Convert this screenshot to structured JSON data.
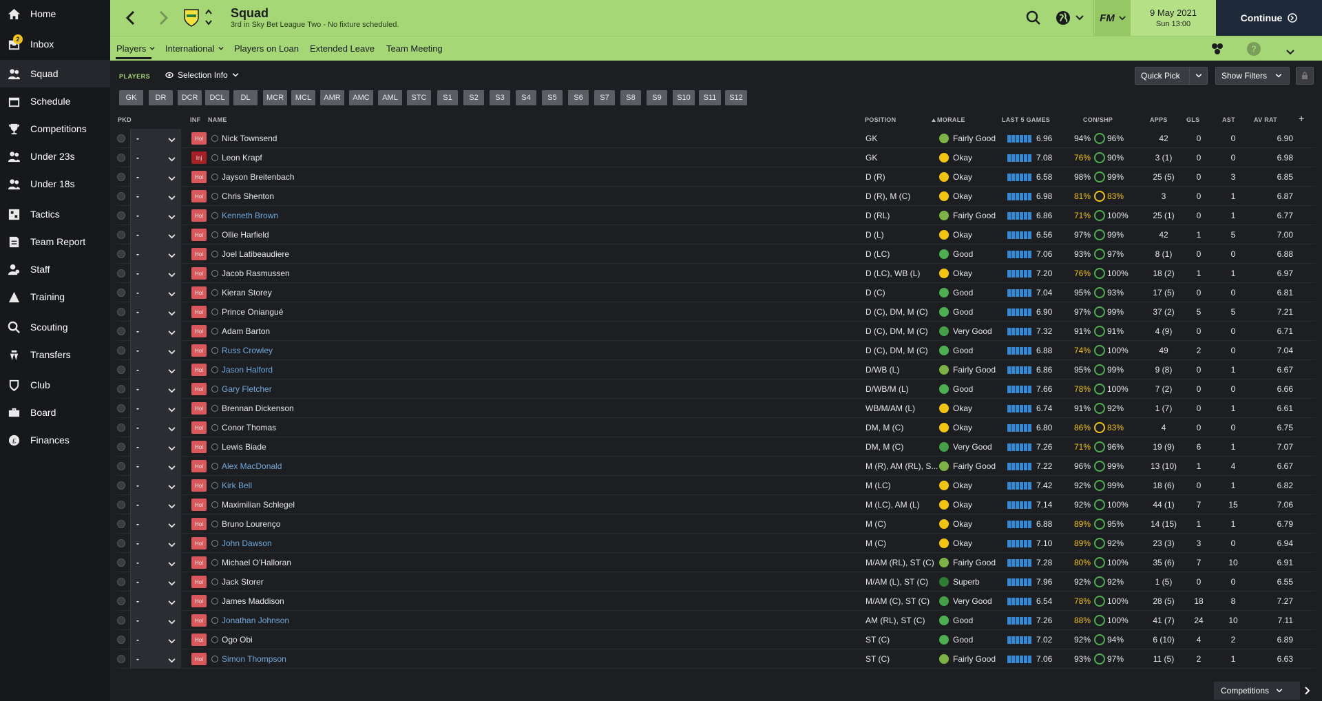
{
  "sidebar": {
    "items": [
      {
        "label": "Home",
        "icon": "home-icon"
      },
      {
        "label": "Inbox",
        "icon": "inbox-icon",
        "badge": "2"
      },
      {
        "label": "Squad",
        "icon": "squad-icon",
        "active": true
      },
      {
        "label": "Schedule",
        "icon": "calendar-icon"
      },
      {
        "label": "Competitions",
        "icon": "trophy-icon"
      },
      {
        "label": "Under 23s",
        "icon": "u23-icon"
      },
      {
        "label": "Under 18s",
        "icon": "u18-icon"
      },
      {
        "label": "Tactics",
        "icon": "tactics-icon"
      },
      {
        "label": "Team Report",
        "icon": "report-icon"
      },
      {
        "label": "Staff",
        "icon": "staff-icon"
      },
      {
        "label": "Training",
        "icon": "training-icon"
      },
      {
        "label": "Scouting",
        "icon": "scouting-icon"
      },
      {
        "label": "Transfers",
        "icon": "transfers-icon"
      },
      {
        "label": "Club",
        "icon": "club-icon"
      },
      {
        "label": "Board",
        "icon": "board-icon"
      },
      {
        "label": "Finances",
        "icon": "finances-icon"
      }
    ]
  },
  "header": {
    "title": "Squad",
    "subtitle": "3rd in Sky Bet League Two - No fixture scheduled.",
    "date": "9 May 2021",
    "time": "Sun 13:00",
    "continue_label": "Continue",
    "fm_label": "FM"
  },
  "subnav": {
    "items": [
      "Players",
      "International",
      "Players on Loan",
      "Extended Leave",
      "Team Meeting"
    ]
  },
  "toolbar": {
    "players_label": "PLAYERS",
    "selection_info": "Selection Info",
    "quick_pick": "Quick Pick",
    "show_filters": "Show Filters"
  },
  "positions": [
    "GK",
    "DR",
    "DCR",
    "DCL",
    "DL",
    "MCR",
    "MCL",
    "AMR",
    "AMC",
    "AML",
    "STC",
    "S1",
    "S2",
    "S3",
    "S4",
    "S5",
    "S6",
    "S7",
    "S8",
    "S9",
    "S10",
    "S11",
    "S12"
  ],
  "columns": {
    "pkd": "PKD",
    "inf": "INF",
    "name": "NAME",
    "position": "POSITION",
    "morale": "MORALE",
    "last5": "LAST 5 GAMES",
    "conshp": "CON/SHP",
    "apps": "APPS",
    "gls": "GLS",
    "ast": "AST",
    "avrat": "AV RAT"
  },
  "players": [
    {
      "pkd": "-",
      "inf": "Hol",
      "name": "Nick Townsend",
      "link": false,
      "position": "GK",
      "morale": "Fairly Good",
      "morale_color": "#7cb342",
      "last5": "6.96",
      "con": "94%",
      "shp": "96%",
      "apps": "42",
      "gls": "0",
      "ast": "0",
      "avrat": "6.90"
    },
    {
      "pkd": "-",
      "inf": "Inj",
      "name": "Leon Krapf",
      "link": false,
      "position": "GK",
      "morale": "Okay",
      "morale_color": "#f1c40f",
      "last5": "7.08",
      "con": "76%",
      "shp": "90%",
      "apps": "3 (1)",
      "gls": "0",
      "ast": "0",
      "avrat": "6.98"
    },
    {
      "pkd": "-",
      "inf": "Hol",
      "name": "Jayson Breitenbach",
      "link": false,
      "position": "D (R)",
      "morale": "Okay",
      "morale_color": "#f1c40f",
      "last5": "6.58",
      "con": "98%",
      "shp": "99%",
      "apps": "25 (5)",
      "gls": "0",
      "ast": "3",
      "avrat": "6.85"
    },
    {
      "pkd": "-",
      "inf": "Hol",
      "name": "Chris Shenton",
      "link": false,
      "position": "D (R), M (C)",
      "morale": "Okay",
      "morale_color": "#f1c40f",
      "last5": "6.98",
      "con": "81%",
      "shp": "83%",
      "apps": "3",
      "gls": "0",
      "ast": "1",
      "avrat": "6.87"
    },
    {
      "pkd": "-",
      "inf": "Hol",
      "name": "Kenneth Brown",
      "link": true,
      "position": "D (RL)",
      "morale": "Fairly Good",
      "morale_color": "#7cb342",
      "last5": "6.86",
      "con": "71%",
      "shp": "100%",
      "apps": "25 (1)",
      "gls": "0",
      "ast": "1",
      "avrat": "6.77"
    },
    {
      "pkd": "-",
      "inf": "Hol",
      "name": "Ollie Harfield",
      "link": false,
      "position": "D (L)",
      "morale": "Okay",
      "morale_color": "#f1c40f",
      "last5": "6.56",
      "con": "97%",
      "shp": "99%",
      "apps": "42",
      "gls": "1",
      "ast": "5",
      "avrat": "7.00"
    },
    {
      "pkd": "-",
      "inf": "Hol",
      "name": "Joel Latibeaudiere",
      "link": false,
      "position": "D (LC)",
      "morale": "Good",
      "morale_color": "#4caf50",
      "last5": "7.06",
      "con": "93%",
      "shp": "97%",
      "apps": "8 (1)",
      "gls": "0",
      "ast": "0",
      "avrat": "6.88"
    },
    {
      "pkd": "-",
      "inf": "Hol",
      "name": "Jacob Rasmussen",
      "link": false,
      "position": "D (LC), WB (L)",
      "morale": "Okay",
      "morale_color": "#f1c40f",
      "last5": "7.20",
      "con": "76%",
      "shp": "100%",
      "apps": "18 (2)",
      "gls": "1",
      "ast": "1",
      "avrat": "6.97"
    },
    {
      "pkd": "-",
      "inf": "Hol",
      "name": "Kieran Storey",
      "link": false,
      "position": "D (C)",
      "morale": "Good",
      "morale_color": "#4caf50",
      "last5": "7.04",
      "con": "95%",
      "shp": "93%",
      "apps": "17 (5)",
      "gls": "0",
      "ast": "0",
      "avrat": "6.81"
    },
    {
      "pkd": "-",
      "inf": "Hol",
      "name": "Prince Oniangué",
      "link": false,
      "position": "D (C), DM, M (C)",
      "morale": "Good",
      "morale_color": "#4caf50",
      "last5": "6.90",
      "con": "97%",
      "shp": "99%",
      "apps": "37 (2)",
      "gls": "5",
      "ast": "5",
      "avrat": "7.21"
    },
    {
      "pkd": "-",
      "inf": "Hol",
      "name": "Adam Barton",
      "link": false,
      "position": "D (C), DM, M (C)",
      "morale": "Very Good",
      "morale_color": "#43a047",
      "last5": "7.32",
      "con": "91%",
      "shp": "91%",
      "apps": "4 (9)",
      "gls": "0",
      "ast": "0",
      "avrat": "6.71"
    },
    {
      "pkd": "-",
      "inf": "Hol",
      "name": "Russ Crowley",
      "link": true,
      "position": "D (C), DM, M (C)",
      "morale": "Good",
      "morale_color": "#4caf50",
      "last5": "6.88",
      "con": "74%",
      "shp": "100%",
      "apps": "49",
      "gls": "2",
      "ast": "0",
      "avrat": "7.04"
    },
    {
      "pkd": "-",
      "inf": "Hol",
      "name": "Jason Halford",
      "link": true,
      "position": "D/WB (L)",
      "morale": "Fairly Good",
      "morale_color": "#7cb342",
      "last5": "6.86",
      "con": "95%",
      "shp": "99%",
      "apps": "9 (8)",
      "gls": "0",
      "ast": "1",
      "avrat": "6.67"
    },
    {
      "pkd": "-",
      "inf": "Hol",
      "name": "Gary Fletcher",
      "link": true,
      "position": "D/WB/M (L)",
      "morale": "Good",
      "morale_color": "#4caf50",
      "last5": "7.66",
      "con": "78%",
      "shp": "100%",
      "apps": "7 (2)",
      "gls": "0",
      "ast": "0",
      "avrat": "6.66"
    },
    {
      "pkd": "-",
      "inf": "Hol",
      "name": "Brennan Dickenson",
      "link": false,
      "position": "WB/M/AM (L)",
      "morale": "Okay",
      "morale_color": "#f1c40f",
      "last5": "6.74",
      "con": "91%",
      "shp": "92%",
      "apps": "1 (7)",
      "gls": "0",
      "ast": "1",
      "avrat": "6.61"
    },
    {
      "pkd": "-",
      "inf": "Hol",
      "name": "Conor Thomas",
      "link": false,
      "position": "DM, M (C)",
      "morale": "Okay",
      "morale_color": "#f1c40f",
      "last5": "6.80",
      "con": "86%",
      "shp": "83%",
      "apps": "4",
      "gls": "0",
      "ast": "0",
      "avrat": "6.75"
    },
    {
      "pkd": "-",
      "inf": "Hol",
      "name": "Lewis Biade",
      "link": false,
      "position": "DM, M (C)",
      "morale": "Very Good",
      "morale_color": "#43a047",
      "last5": "7.26",
      "con": "71%",
      "shp": "96%",
      "apps": "19 (9)",
      "gls": "6",
      "ast": "1",
      "avrat": "7.07"
    },
    {
      "pkd": "-",
      "inf": "Hol",
      "name": "Alex MacDonald",
      "link": true,
      "position": "M (R), AM (RL), S...",
      "morale": "Fairly Good",
      "morale_color": "#7cb342",
      "last5": "7.22",
      "con": "96%",
      "shp": "99%",
      "apps": "13 (10)",
      "gls": "1",
      "ast": "4",
      "avrat": "6.67"
    },
    {
      "pkd": "-",
      "inf": "Hol",
      "name": "Kirk Bell",
      "link": true,
      "position": "M (LC)",
      "morale": "Okay",
      "morale_color": "#f1c40f",
      "last5": "7.42",
      "con": "92%",
      "shp": "99%",
      "apps": "18 (6)",
      "gls": "0",
      "ast": "1",
      "avrat": "6.82"
    },
    {
      "pkd": "-",
      "inf": "Hol",
      "name": "Maximilian Schlegel",
      "link": false,
      "position": "M (LC), AM (L)",
      "morale": "Okay",
      "morale_color": "#f1c40f",
      "last5": "7.14",
      "con": "92%",
      "shp": "100%",
      "apps": "44 (1)",
      "gls": "7",
      "ast": "15",
      "avrat": "7.06"
    },
    {
      "pkd": "-",
      "inf": "Hol",
      "name": "Bruno Lourenço",
      "link": false,
      "position": "M (C)",
      "morale": "Okay",
      "morale_color": "#f1c40f",
      "last5": "6.88",
      "con": "89%",
      "shp": "95%",
      "apps": "14 (15)",
      "gls": "1",
      "ast": "1",
      "avrat": "6.79"
    },
    {
      "pkd": "-",
      "inf": "Hol",
      "name": "John Dawson",
      "link": true,
      "position": "M (C)",
      "morale": "Okay",
      "morale_color": "#f1c40f",
      "last5": "7.10",
      "con": "89%",
      "shp": "92%",
      "apps": "23 (3)",
      "gls": "3",
      "ast": "0",
      "avrat": "6.94"
    },
    {
      "pkd": "-",
      "inf": "Hol",
      "name": "Michael O'Halloran",
      "link": false,
      "position": "M/AM (RL), ST (C)",
      "morale": "Fairly Good",
      "morale_color": "#7cb342",
      "last5": "7.28",
      "con": "80%",
      "shp": "100%",
      "apps": "35 (6)",
      "gls": "7",
      "ast": "10",
      "avrat": "6.91"
    },
    {
      "pkd": "-",
      "inf": "Hol",
      "name": "Jack Storer",
      "link": false,
      "position": "M/AM (L), ST (C)",
      "morale": "Superb",
      "morale_color": "#2e7d32",
      "last5": "7.96",
      "con": "92%",
      "shp": "92%",
      "apps": "1 (5)",
      "gls": "0",
      "ast": "0",
      "avrat": "6.55"
    },
    {
      "pkd": "-",
      "inf": "Hol",
      "name": "James Maddison",
      "link": false,
      "position": "M/AM (C), ST (C)",
      "morale": "Very Good",
      "morale_color": "#43a047",
      "last5": "6.54",
      "con": "78%",
      "shp": "100%",
      "apps": "28 (5)",
      "gls": "18",
      "ast": "8",
      "avrat": "7.27"
    },
    {
      "pkd": "-",
      "inf": "Hol",
      "name": "Jonathan Johnson",
      "link": true,
      "position": "AM (RL), ST (C)",
      "morale": "Good",
      "morale_color": "#4caf50",
      "last5": "7.26",
      "con": "88%",
      "shp": "100%",
      "apps": "41 (7)",
      "gls": "24",
      "ast": "10",
      "avrat": "7.11"
    },
    {
      "pkd": "-",
      "inf": "Hol",
      "name": "Ogo Obi",
      "link": false,
      "position": "ST (C)",
      "morale": "Good",
      "morale_color": "#4caf50",
      "last5": "7.02",
      "con": "92%",
      "shp": "94%",
      "apps": "6 (10)",
      "gls": "4",
      "ast": "2",
      "avrat": "6.89"
    },
    {
      "pkd": "-",
      "inf": "Hol",
      "name": "Simon Thompson",
      "link": true,
      "position": "ST (C)",
      "morale": "Fairly Good",
      "morale_color": "#7cb342",
      "last5": "7.06",
      "con": "93%",
      "shp": "97%",
      "apps": "11 (5)",
      "gls": "2",
      "ast": "1",
      "avrat": "6.63"
    }
  ],
  "footer": {
    "competitions": "Competitions"
  },
  "colors": {
    "accent": "#a5d777",
    "background": "#1d1e22",
    "sidebar": "#17181b",
    "link": "#6fa8dc",
    "injury": "#a62126",
    "holiday": "#d9585c"
  }
}
